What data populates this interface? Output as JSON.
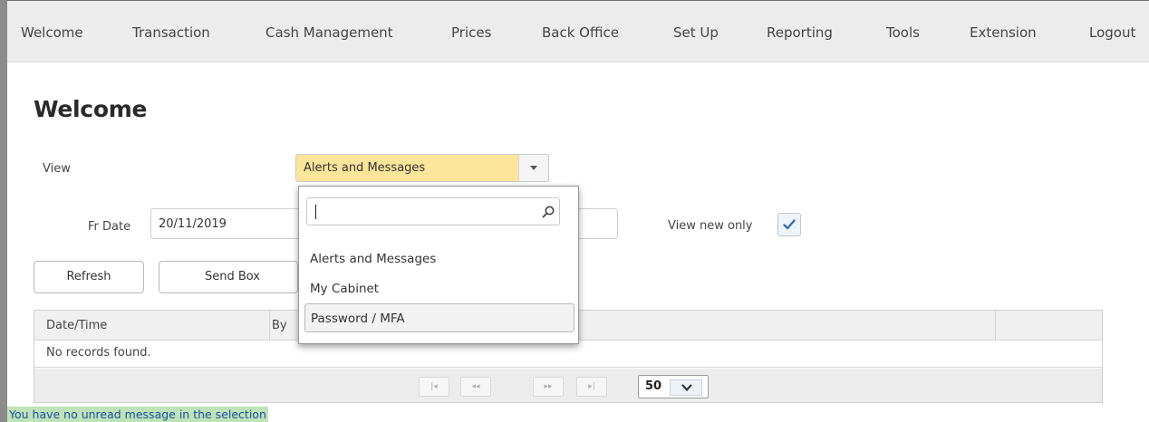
{
  "nav": {
    "items": [
      "Welcome",
      "Transaction",
      "Cash Management",
      "Prices",
      "Back Office",
      "Set Up",
      "Reporting",
      "Tools",
      "Extension",
      "Logout"
    ]
  },
  "page": {
    "title": "Welcome"
  },
  "filters": {
    "view_label": "View",
    "view_value": "Alerts and Messages",
    "from_date_label": "Fr Date",
    "from_date_value": "20/11/2019",
    "view_new_only_label": "View new only",
    "view_new_only_checked": true
  },
  "buttons": {
    "refresh": "Refresh",
    "send_box": "Send Box"
  },
  "grid": {
    "columns": [
      "Date/Time",
      "By"
    ],
    "empty_text": "No records found.",
    "pager": {
      "first": "|◂",
      "prev": "◂◂",
      "next": "▸▸",
      "last": "▸|",
      "page_size": "50"
    }
  },
  "dropdown": {
    "search_value": "",
    "options": [
      "Alerts and Messages",
      "My Cabinet",
      "Password / MFA"
    ],
    "highlighted_index": 2
  },
  "status": {
    "message": "You have no unread message in the selection"
  },
  "colors": {
    "select_bg": "#fbe59a",
    "status_bg": "#bfe3b8",
    "status_text": "#1a4fa0"
  }
}
